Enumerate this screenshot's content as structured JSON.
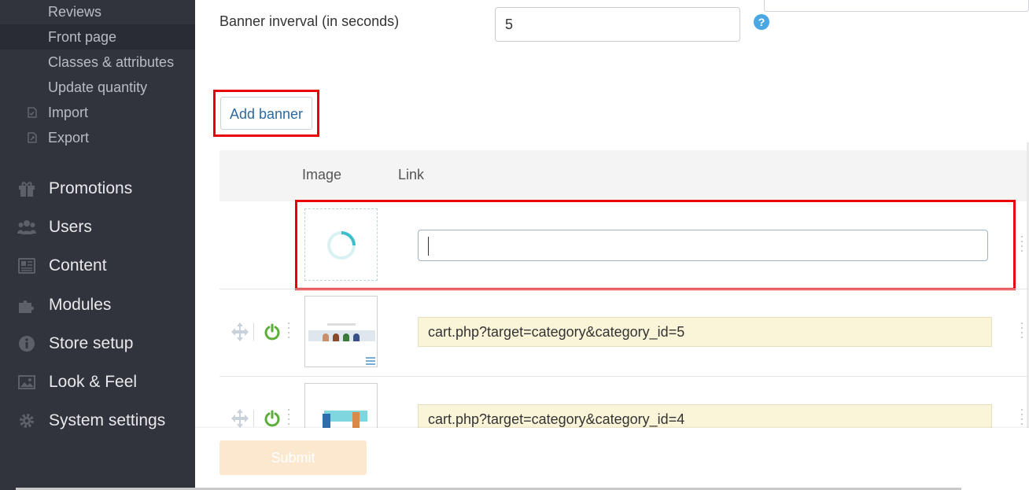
{
  "sidebar": {
    "sub_items": [
      {
        "label": "Reviews",
        "icon": null
      },
      {
        "label": "Front page",
        "icon": null
      },
      {
        "label": "Classes & attributes",
        "icon": null
      },
      {
        "label": "Update quantity",
        "icon": null
      },
      {
        "label": "Import",
        "icon": "import-icon"
      },
      {
        "label": "Export",
        "icon": "export-icon"
      }
    ],
    "main_items": [
      {
        "label": "Promotions",
        "icon": "gift-icon"
      },
      {
        "label": "Users",
        "icon": "users-icon"
      },
      {
        "label": "Content",
        "icon": "newspaper-icon"
      },
      {
        "label": "Modules",
        "icon": "puzzle-icon"
      },
      {
        "label": "Store setup",
        "icon": "info-icon"
      },
      {
        "label": "Look & Feel",
        "icon": "image-icon"
      },
      {
        "label": "System settings",
        "icon": "gear-icon"
      }
    ]
  },
  "form": {
    "interval_label": "Banner inverval (in seconds)",
    "interval_value": "5",
    "help": "?"
  },
  "banners": {
    "add_label": "Add banner",
    "col_image": "Image",
    "col_link": "Link",
    "new_row_link": "",
    "rows": [
      {
        "link": "cart.php?target=category&category_id=5"
      },
      {
        "link": "cart.php?target=category&category_id=4"
      }
    ]
  },
  "footer": {
    "submit_label": "Submit"
  },
  "colors": {
    "sidebar": "#32343d",
    "highlight": "#e8000b",
    "power": "#5cae3a",
    "spinner": "#3bbfcc"
  }
}
